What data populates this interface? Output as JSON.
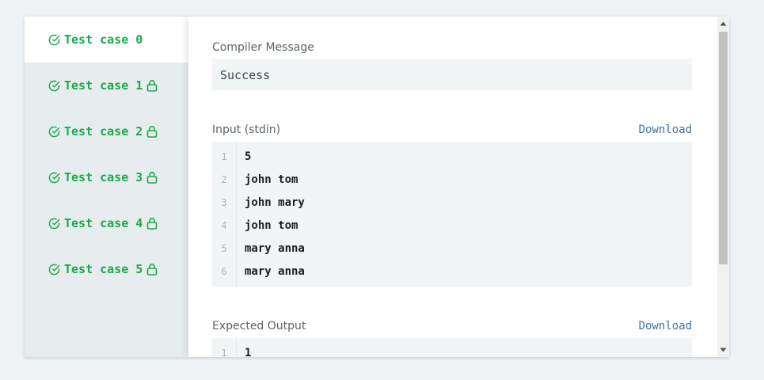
{
  "sidebar": {
    "tabs": [
      {
        "label": "Test case 0",
        "locked": false,
        "active": true
      },
      {
        "label": "Test case 1",
        "locked": true,
        "active": false
      },
      {
        "label": "Test case 2",
        "locked": true,
        "active": false
      },
      {
        "label": "Test case 3",
        "locked": true,
        "active": false
      },
      {
        "label": "Test case 4",
        "locked": true,
        "active": false
      },
      {
        "label": "Test case 5",
        "locked": true,
        "active": false
      }
    ],
    "status_icon": "check-circle-icon",
    "lock_icon": "lock-icon",
    "status_color": "#1ba94c"
  },
  "compiler": {
    "label": "Compiler Message",
    "message": "Success"
  },
  "input": {
    "label": "Input (stdin)",
    "download_label": "Download",
    "lines": [
      {
        "n": "1",
        "text": "5"
      },
      {
        "n": "2",
        "text": "john tom"
      },
      {
        "n": "3",
        "text": "john mary"
      },
      {
        "n": "4",
        "text": "john tom"
      },
      {
        "n": "5",
        "text": "mary anna"
      },
      {
        "n": "6",
        "text": "mary anna"
      }
    ]
  },
  "expected": {
    "label": "Expected Output",
    "download_label": "Download",
    "lines": [
      {
        "n": "1",
        "text": "1"
      }
    ]
  },
  "colors": {
    "link": "#3b73a8",
    "code_bg": "#f2f5f5"
  }
}
